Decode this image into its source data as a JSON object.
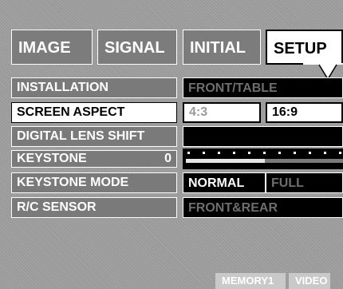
{
  "tabs": [
    {
      "label": "IMAGE",
      "active": false
    },
    {
      "label": "SIGNAL",
      "active": false
    },
    {
      "label": "INITIAL",
      "active": false
    },
    {
      "label": "SETUP",
      "active": true
    }
  ],
  "rows": {
    "installation": {
      "label": "INSTALLATION",
      "value": "FRONT/TABLE"
    },
    "screen_aspect": {
      "label": "SCREEN ASPECT",
      "options": [
        "4:3",
        "16:9"
      ],
      "selected": "16:9"
    },
    "digital_lens_shift": {
      "label": "DIGITAL LENS SHIFT"
    },
    "keystone": {
      "label": "KEYSTONE",
      "value": "0",
      "level_fraction": 0.5
    },
    "keystone_mode": {
      "label": "KEYSTONE MODE",
      "options": [
        "NORMAL",
        "FULL"
      ],
      "selected": "NORMAL"
    },
    "rc_sensor": {
      "label": "R/C SENSOR",
      "value": "FRONT&REAR"
    }
  },
  "footer": {
    "memory": "MEMORY1",
    "input": "VIDEO"
  },
  "colors": {
    "panel": "#9a9a9a",
    "label_bg": "#7a7a7a",
    "value_bg": "#000000",
    "highlight": "#ffffff"
  },
  "icons": {
    "tab_pointer": "speech-pointer-icon"
  }
}
